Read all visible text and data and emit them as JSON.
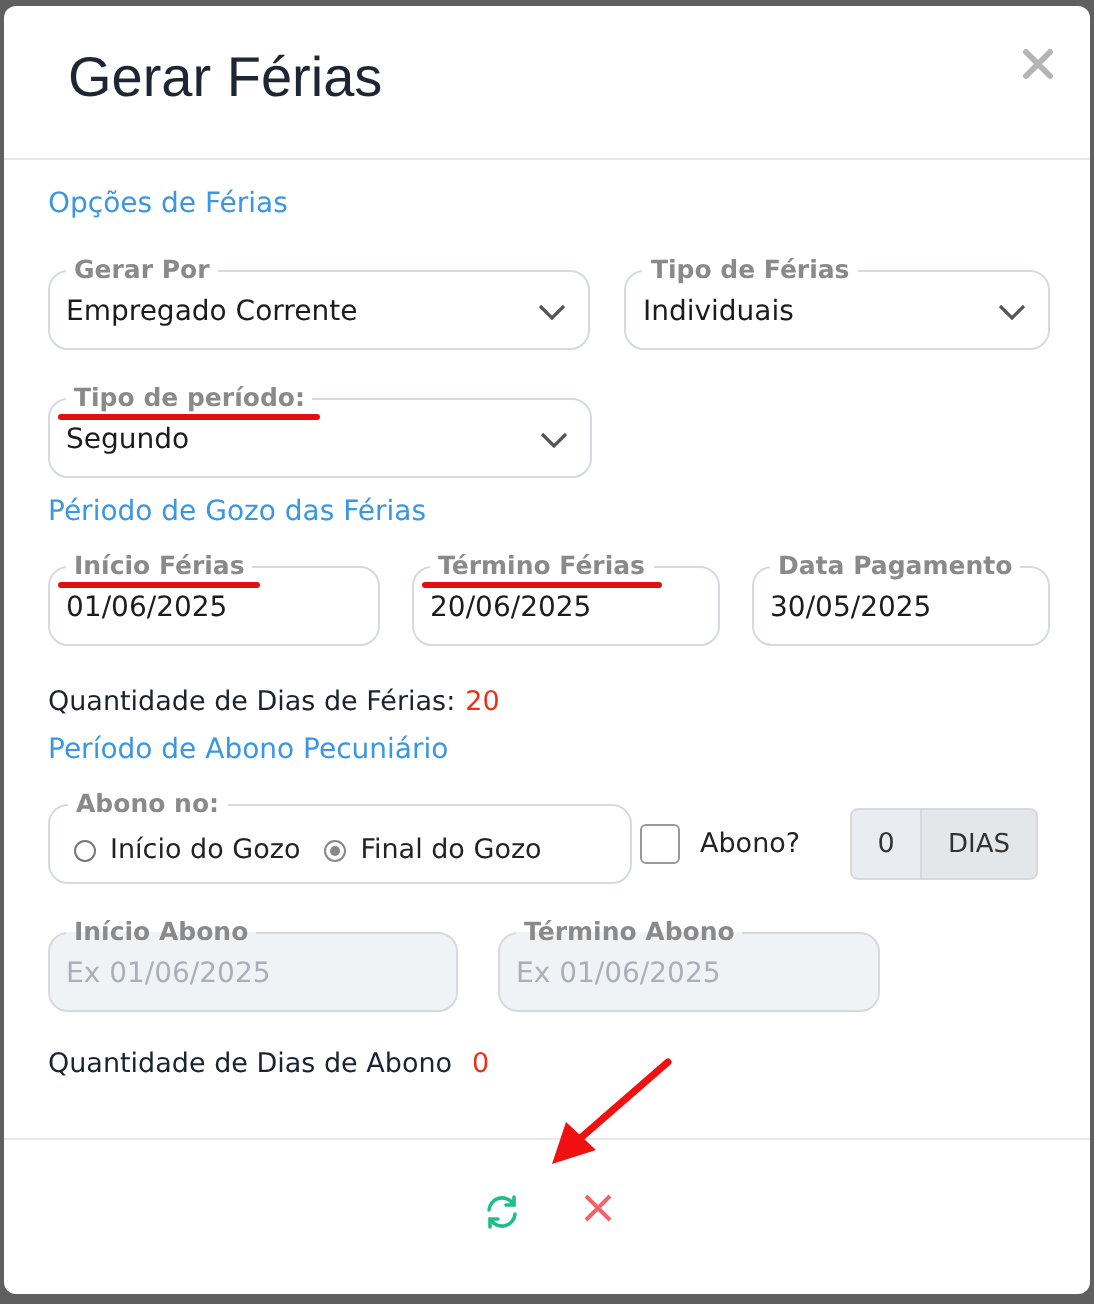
{
  "dialog": {
    "title": "Gerar Férias"
  },
  "options_heading": "Opções de Férias",
  "selects": [
    {
      "label": "Gerar Por",
      "value": "Empregado Corrente",
      "highlighted": false
    },
    {
      "label": "Tipo de Férias",
      "value": "Individuais",
      "highlighted": false
    },
    {
      "label": "Tipo de período:",
      "value": "Segundo",
      "highlighted": true
    }
  ],
  "gozo_heading": "Périodo de Gozo das Férias",
  "date_fields": [
    {
      "label": "Início Férias",
      "value": "01/06/2025",
      "highlighted": true
    },
    {
      "label": "Término Férias",
      "value": "20/06/2025",
      "highlighted": true
    },
    {
      "label": "Data Pagamento",
      "value": "30/05/2025",
      "highlighted": false
    }
  ],
  "ferias_days": {
    "label": "Quantidade de Dias de Férias:",
    "value": "20"
  },
  "abono_heading": "Período de Abono Pecuniário",
  "abono_no": {
    "legend": "Abono no:",
    "options": [
      {
        "label": "Início do Gozo",
        "selected": false
      },
      {
        "label": "Final do Gozo",
        "selected": true
      }
    ]
  },
  "abono_check": {
    "label": "Abono?",
    "checked": false
  },
  "abono_days": {
    "value": "0",
    "unit": "DIAS"
  },
  "abono_dates": [
    {
      "label": "Início Abono",
      "placeholder": "Ex 01/06/2025",
      "disabled": true
    },
    {
      "label": "Término Abono",
      "placeholder": "Ex 01/06/2025",
      "disabled": true
    }
  ],
  "abono_total": {
    "label": "Quantidade de Dias de Abono",
    "value": "0"
  },
  "footer_buttons": [
    {
      "kind": "refresh"
    },
    {
      "kind": "cancel"
    }
  ]
}
